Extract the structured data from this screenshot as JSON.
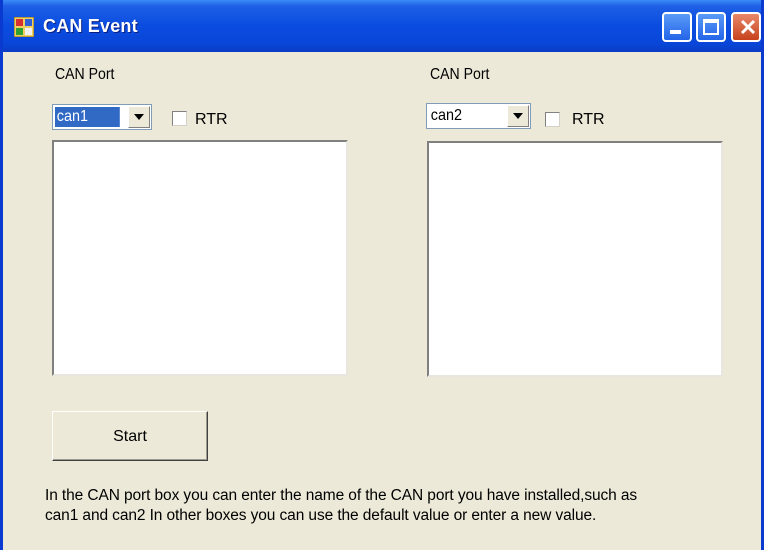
{
  "window": {
    "title": "CAN Event"
  },
  "left_panel": {
    "port_label": "CAN Port",
    "port_value": "can1",
    "rtr_label": "RTR",
    "rtr_checked": false
  },
  "right_panel": {
    "port_label": "CAN Port",
    "port_value": "can2",
    "rtr_label": "RTR",
    "rtr_checked": false
  },
  "start_button": {
    "label": "Start"
  },
  "info": {
    "line1": "In the CAN port box you can enter the name of the CAN port you have installed,such as",
    "line2": "can1 and can2 In other boxes you can use the default value or enter a new value."
  },
  "colors": {
    "titlebar": "#0a4ce0",
    "window_bg": "#ece9d8",
    "selection": "#316ac5",
    "close_button": "#d4502c"
  }
}
